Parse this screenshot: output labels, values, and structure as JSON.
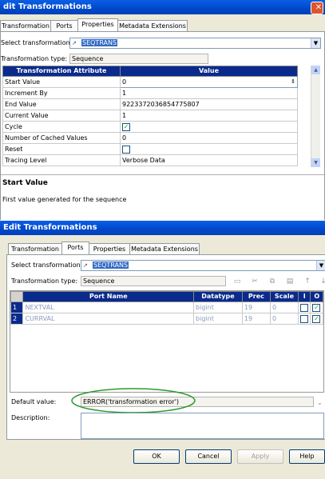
{
  "back_dialog": {
    "title": "dit Transformations",
    "tabs": [
      "Transformation",
      "Ports",
      "Properties",
      "Metadata Extensions"
    ],
    "select_label": "Select transformation:",
    "select_value": "SEQTRANS",
    "type_label": "Transformation type:",
    "type_value": "Sequence",
    "table": {
      "headers": [
        "Transformation Attribute",
        "Value"
      ],
      "rows": [
        {
          "attr": "Start Value",
          "value": "0"
        },
        {
          "attr": "Increment By",
          "value": "1"
        },
        {
          "attr": "End Value",
          "value": "9223372036854775807"
        },
        {
          "attr": "Current Value",
          "value": "1"
        },
        {
          "attr": "Cycle",
          "value": "",
          "checked": true
        },
        {
          "attr": "Number of Cached Values",
          "value": "0"
        },
        {
          "attr": "Reset",
          "value": "",
          "checked": false
        },
        {
          "attr": "Tracing Level",
          "value": "Verbose Data"
        }
      ]
    },
    "desc_title": "Start Value",
    "desc_text": "First value generated for the sequence"
  },
  "front_dialog": {
    "title": "Edit Transformations",
    "tabs": [
      "Transformation",
      "Ports",
      "Properties",
      "Metadata Extensions"
    ],
    "select_label": "Select transformation:",
    "select_value": "SEQTRANS",
    "type_label": "Transformation type:",
    "type_value": "Sequence",
    "table": {
      "headers": [
        "Port Name",
        "Datatype",
        "Prec",
        "Scale",
        "I",
        "O"
      ],
      "rows": [
        {
          "num": "1",
          "name": "NEXTVAL",
          "type": "bigint",
          "prec": "19",
          "scale": "0"
        },
        {
          "num": "2",
          "name": "CURRVAL",
          "type": "bigint",
          "prec": "19",
          "scale": "0"
        }
      ]
    },
    "default_label": "Default value:",
    "default_value": "ERROR('transformation error')",
    "desc_label": "Description:",
    "buttons": {
      "ok": "OK",
      "cancel": "Cancel",
      "apply": "Apply",
      "help": "Help"
    }
  },
  "colors": {
    "titlebar": "#0048c8",
    "header": "#0a2a8c",
    "highlight": "#316ac5",
    "oval": "#2e9a2e"
  }
}
